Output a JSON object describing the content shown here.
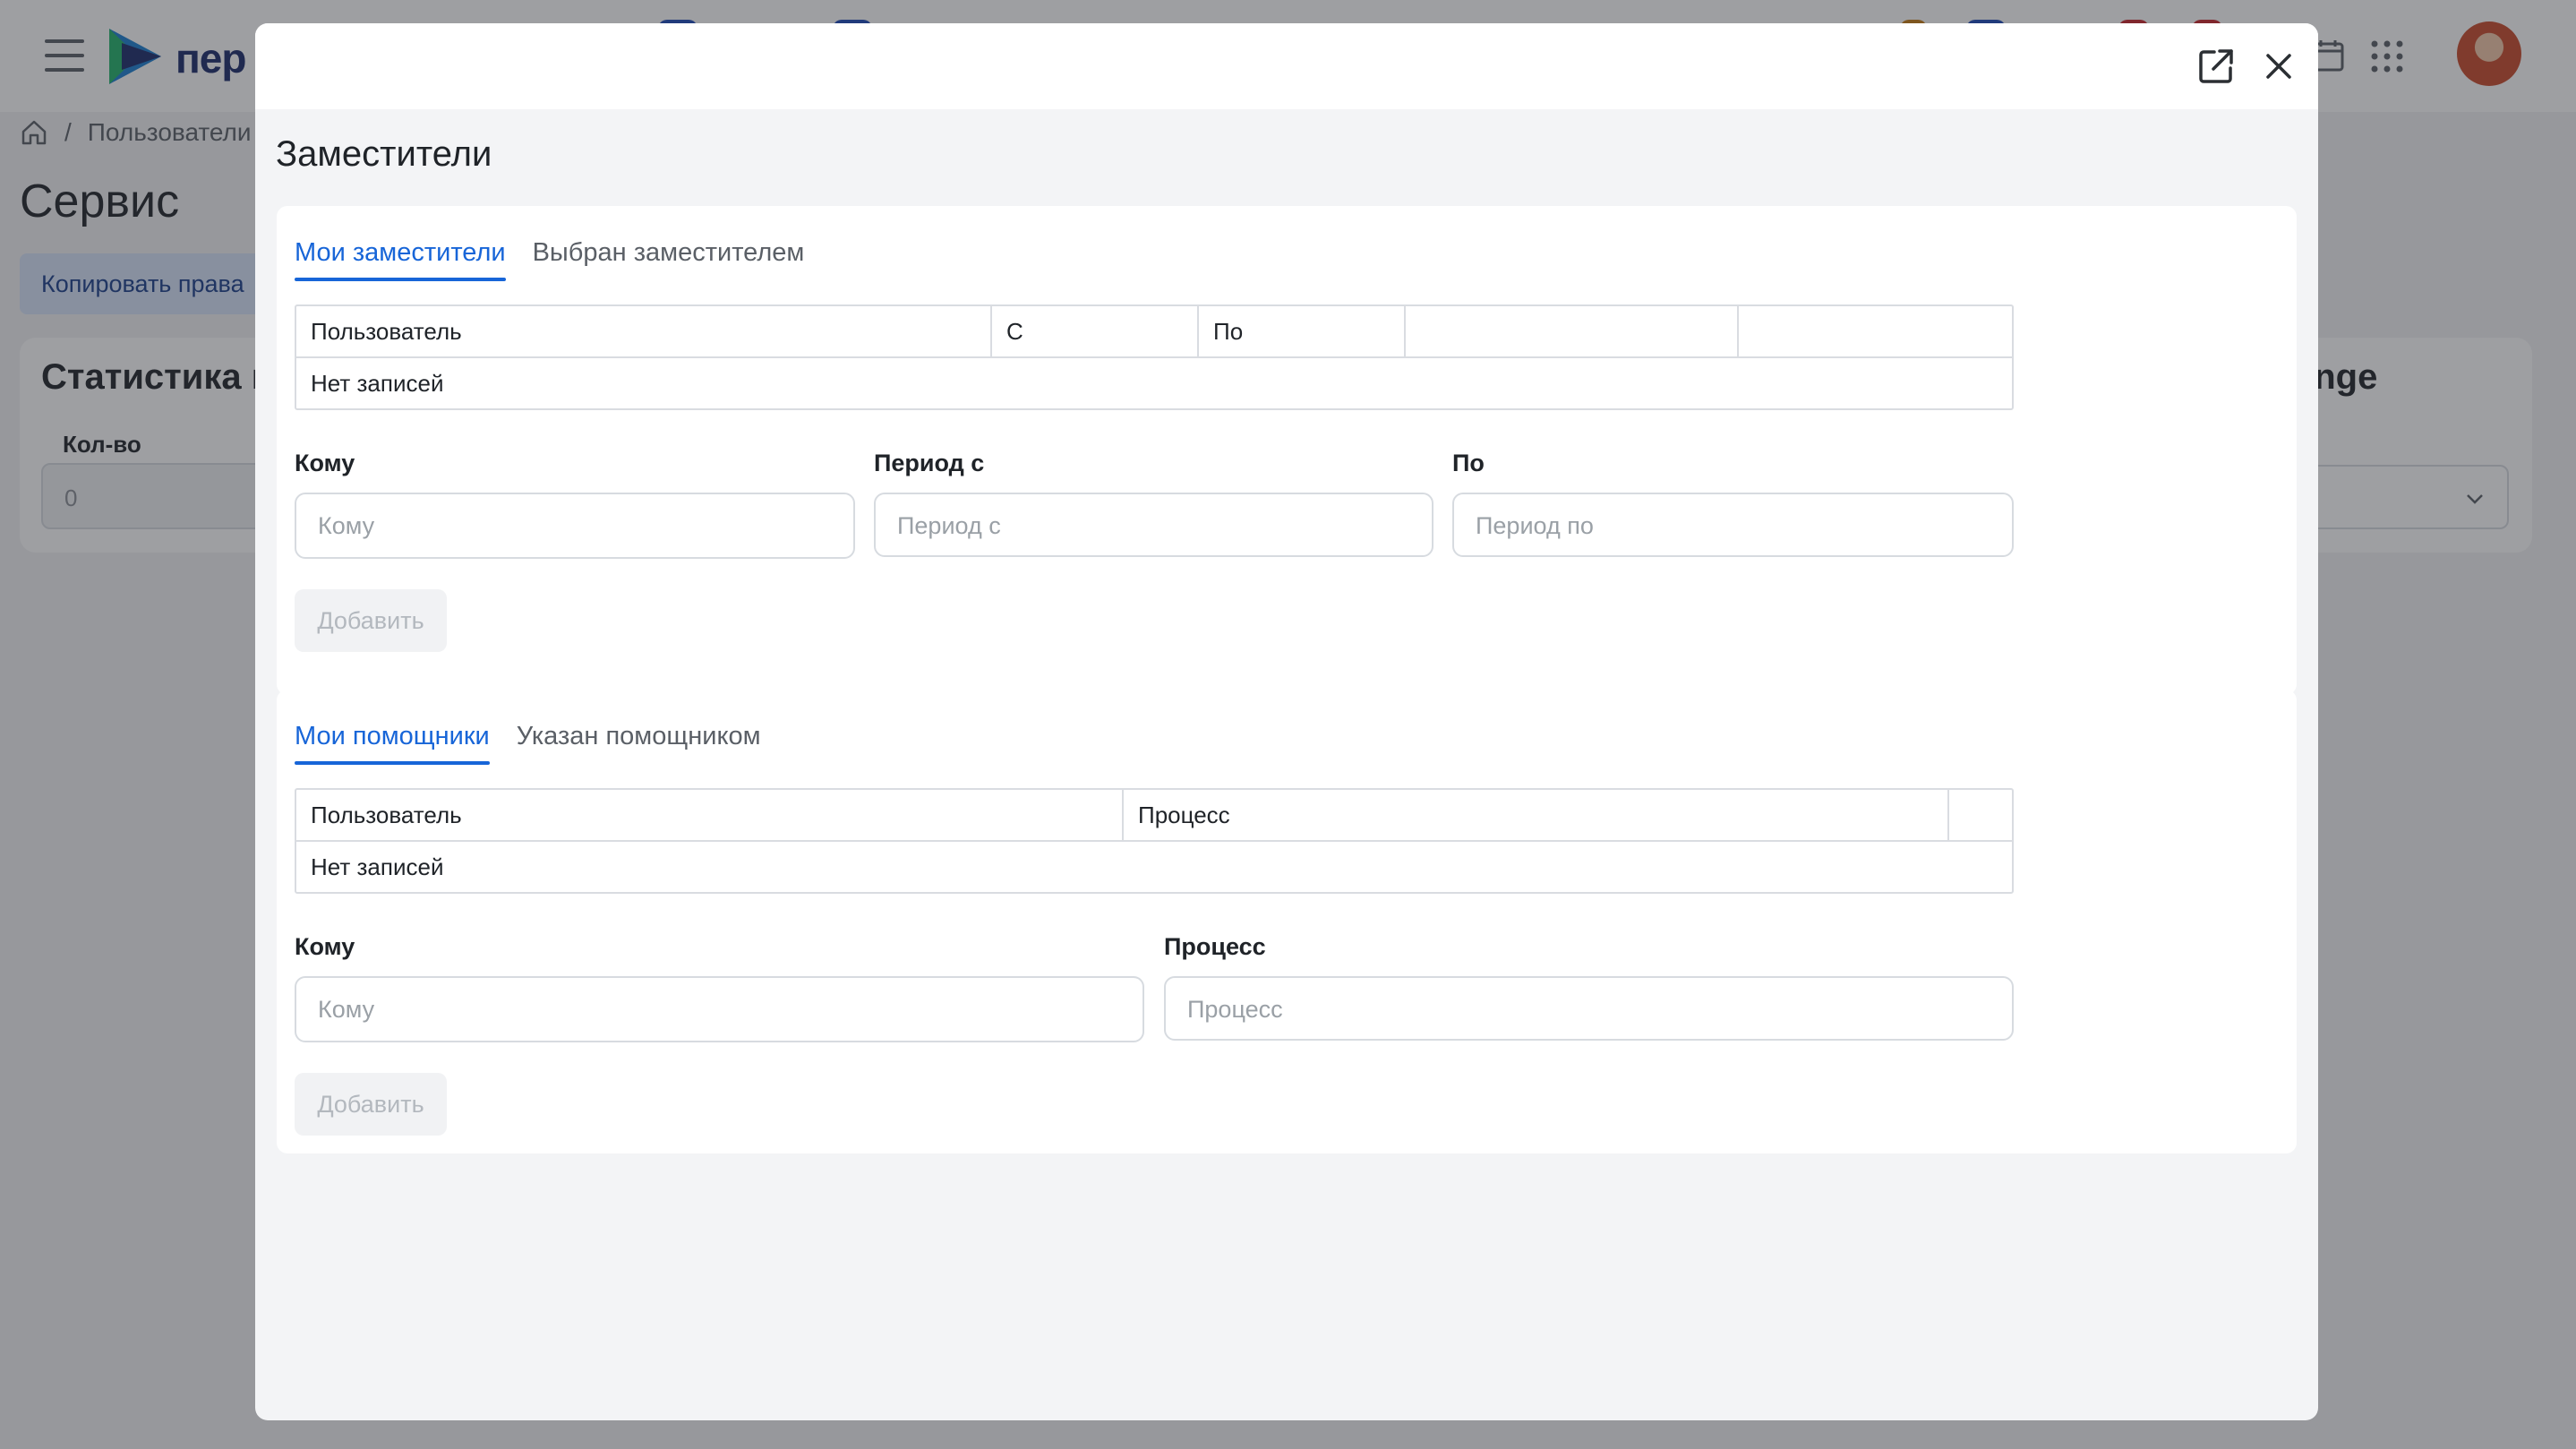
{
  "app": {
    "logo_text": "пер",
    "breadcrumb": {
      "current": "Пользователи"
    },
    "page_title": "Сервис",
    "copy_button": "Копировать права",
    "stats": {
      "title": "Статистика к",
      "range_title": "ange",
      "qty_label": "Кол-во",
      "qty_value": "0"
    }
  },
  "modal": {
    "title": "Заместители",
    "deputies": {
      "tabs": [
        {
          "label": "Мои заместители",
          "active": true
        },
        {
          "label": "Выбран заместителем",
          "active": false
        }
      ],
      "table": {
        "columns": [
          "Пользователь",
          "С",
          "По",
          "",
          ""
        ],
        "empty_text": "Нет записей"
      },
      "form": {
        "to_label": "Кому",
        "to_placeholder": "Кому",
        "from_label": "Период с",
        "from_placeholder": "Период с",
        "until_label": "По",
        "until_placeholder": "Период по",
        "add_button": "Добавить"
      }
    },
    "assistants": {
      "tabs": [
        {
          "label": "Мои помощники",
          "active": true
        },
        {
          "label": "Указан помощником",
          "active": false
        }
      ],
      "table": {
        "columns": [
          "Пользователь",
          "Процесс",
          ""
        ],
        "empty_text": "Нет записей"
      },
      "form": {
        "to_label": "Кому",
        "to_placeholder": "Кому",
        "process_label": "Процесс",
        "process_placeholder": "Процесс",
        "add_button": "Добавить"
      }
    }
  },
  "colors": {
    "accent": "#1765d8",
    "overlay": "rgba(40,42,48,0.45)",
    "logo": "#1b2a6b"
  },
  "icons": [
    "menu-icon",
    "home-icon",
    "calendar-icon",
    "apps-grid-icon",
    "open-external-icon",
    "close-icon",
    "chevron-down-icon"
  ]
}
